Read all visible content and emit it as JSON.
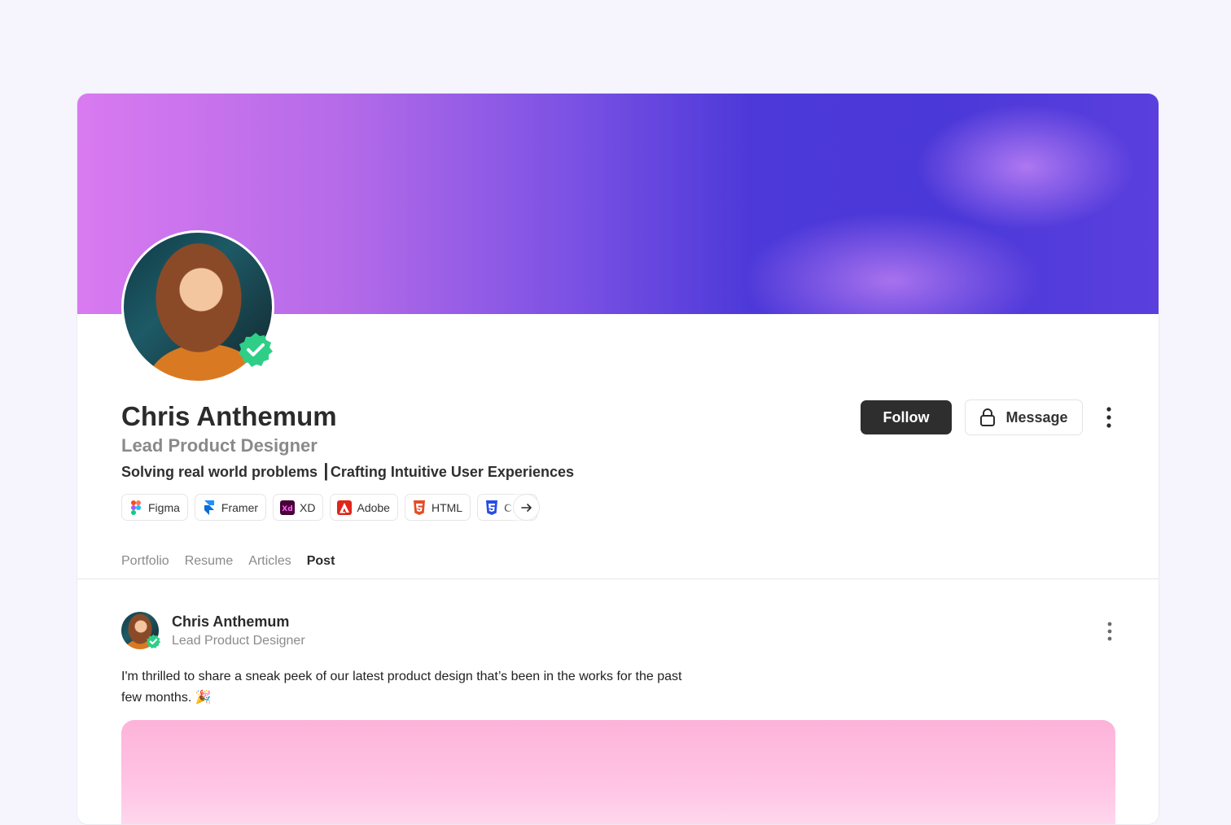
{
  "profile": {
    "name": "Chris Anthemum",
    "role": "Lead Product Designer",
    "tagline": "Solving real world problems  ┃Crafting Intuitive User Experiences",
    "verified": true
  },
  "skills": [
    {
      "label": "Figma",
      "icon": "figma-icon"
    },
    {
      "label": "Framer",
      "icon": "framer-icon"
    },
    {
      "label": "XD",
      "icon": "xd-icon"
    },
    {
      "label": "Adobe",
      "icon": "adobe-icon"
    },
    {
      "label": "HTML",
      "icon": "html5-icon"
    },
    {
      "label": "CSS",
      "icon": "css3-icon"
    }
  ],
  "actions": {
    "follow_label": "Follow",
    "message_label": "Message"
  },
  "tabs": [
    {
      "label": "Portfolio",
      "active": false
    },
    {
      "label": "Resume",
      "active": false
    },
    {
      "label": "Articles",
      "active": false
    },
    {
      "label": "Post",
      "active": true
    }
  ],
  "post": {
    "author_name": "Chris Anthemum",
    "author_role": "Lead Product Designer",
    "text_line1": "I'm thrilled to share a sneak peek of our latest product design that’s been in the works for the past",
    "text_line2": "few months. 🎉"
  },
  "colors": {
    "accent_dark": "#2e2e2e",
    "verified_green": "#2fce86",
    "cover_start": "#d97af0",
    "cover_end": "#4b38d8"
  }
}
